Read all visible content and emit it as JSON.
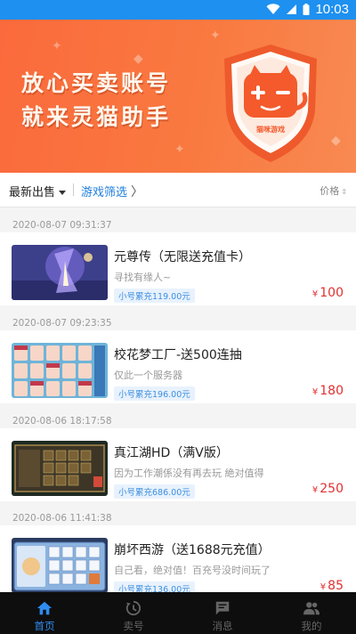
{
  "status_bar": {
    "time": "10:03",
    "icons": [
      "wifi-icon",
      "signal-icon",
      "battery-icon"
    ]
  },
  "banner": {
    "line1": "放心买卖账号",
    "line2": "就来灵猫助手",
    "badge_text": "猫咪游戏"
  },
  "filter_bar": {
    "sort_label": "最新出售",
    "game_filter_label": "游戏筛选",
    "price_label": "价格"
  },
  "listings": [
    {
      "time": "2020-08-07 09:31:37",
      "title": "元尊传（无限送充值卡）",
      "desc": "寻找有缘人~",
      "tag": "小号累充119.00元",
      "price": "100",
      "currency": "¥"
    },
    {
      "time": "2020-08-07 09:23:35",
      "title": "校花梦工厂-送500连抽",
      "desc": "仅此一个服务器",
      "tag": "小号累充196.00元",
      "price": "180",
      "currency": "¥"
    },
    {
      "time": "2020-08-06 18:17:58",
      "title": "真江湖HD（满V版）",
      "desc": "因为工作潮係没有再去玩 絶对值得",
      "tag": "小号累充686.00元",
      "price": "250",
      "currency": "¥"
    },
    {
      "time": "2020-08-06 11:41:38",
      "title": "崩坏西游（送1688元充值）",
      "desc": "自己看，绝对值！百充号没时间玩了",
      "tag": "小号累充136.00元",
      "price": "85",
      "currency": "¥"
    }
  ],
  "tabs": [
    {
      "label": "首页",
      "icon": "home-icon",
      "active": true
    },
    {
      "label": "卖号",
      "icon": "history-icon",
      "active": false
    },
    {
      "label": "消息",
      "icon": "message-icon",
      "active": false
    },
    {
      "label": "我的",
      "icon": "people-icon",
      "active": false
    }
  ],
  "colors": {
    "accent": "#2f8cf0",
    "status_bar": "#1e90f0",
    "banner": "#fb6a3c",
    "price": "#e03030",
    "tab_bar": "#0e0e0e"
  }
}
